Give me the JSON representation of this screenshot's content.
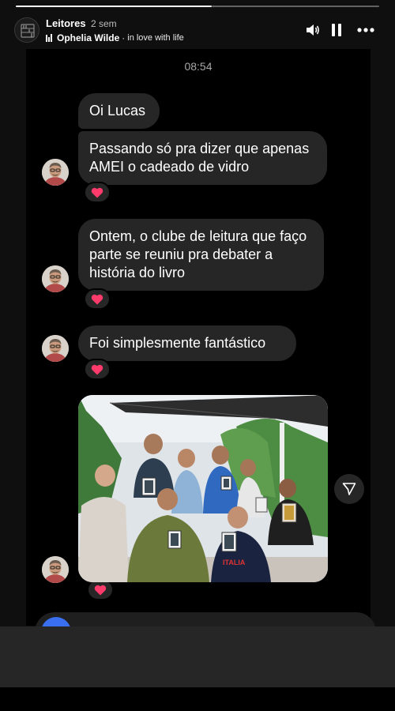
{
  "story": {
    "username": "Leitores",
    "time_ago": "2 sem",
    "music": {
      "artist": "Ophelia Wilde",
      "separator": "·",
      "song": "in love with life"
    },
    "progress_fraction": 0.54,
    "controls": [
      "volume-icon",
      "pause-icon",
      "more-icon"
    ]
  },
  "chat": {
    "timestamp": "08:54",
    "messages": [
      {
        "text": "Oi Lucas",
        "reaction": "heart"
      },
      {
        "text": "Passando só pra dizer que apenas AMEI o cadeado de vidro",
        "reaction": "heart"
      },
      {
        "text": "Ontem, o clube de leitura que faço parte se reuniu pra debater a história do livro",
        "reaction": "heart"
      },
      {
        "text": "Foi simplesmente fantástico",
        "reaction": "heart"
      }
    ],
    "photo": {
      "kind": "group-photo",
      "people_count": 9
    }
  },
  "colors": {
    "background": "#000000",
    "bubble": "#262626",
    "reaction_heart": "#ff3b6b",
    "composer_camera": "#3a6ff0",
    "text_primary": "#ffffff",
    "text_secondary": "#a8a8a8"
  }
}
